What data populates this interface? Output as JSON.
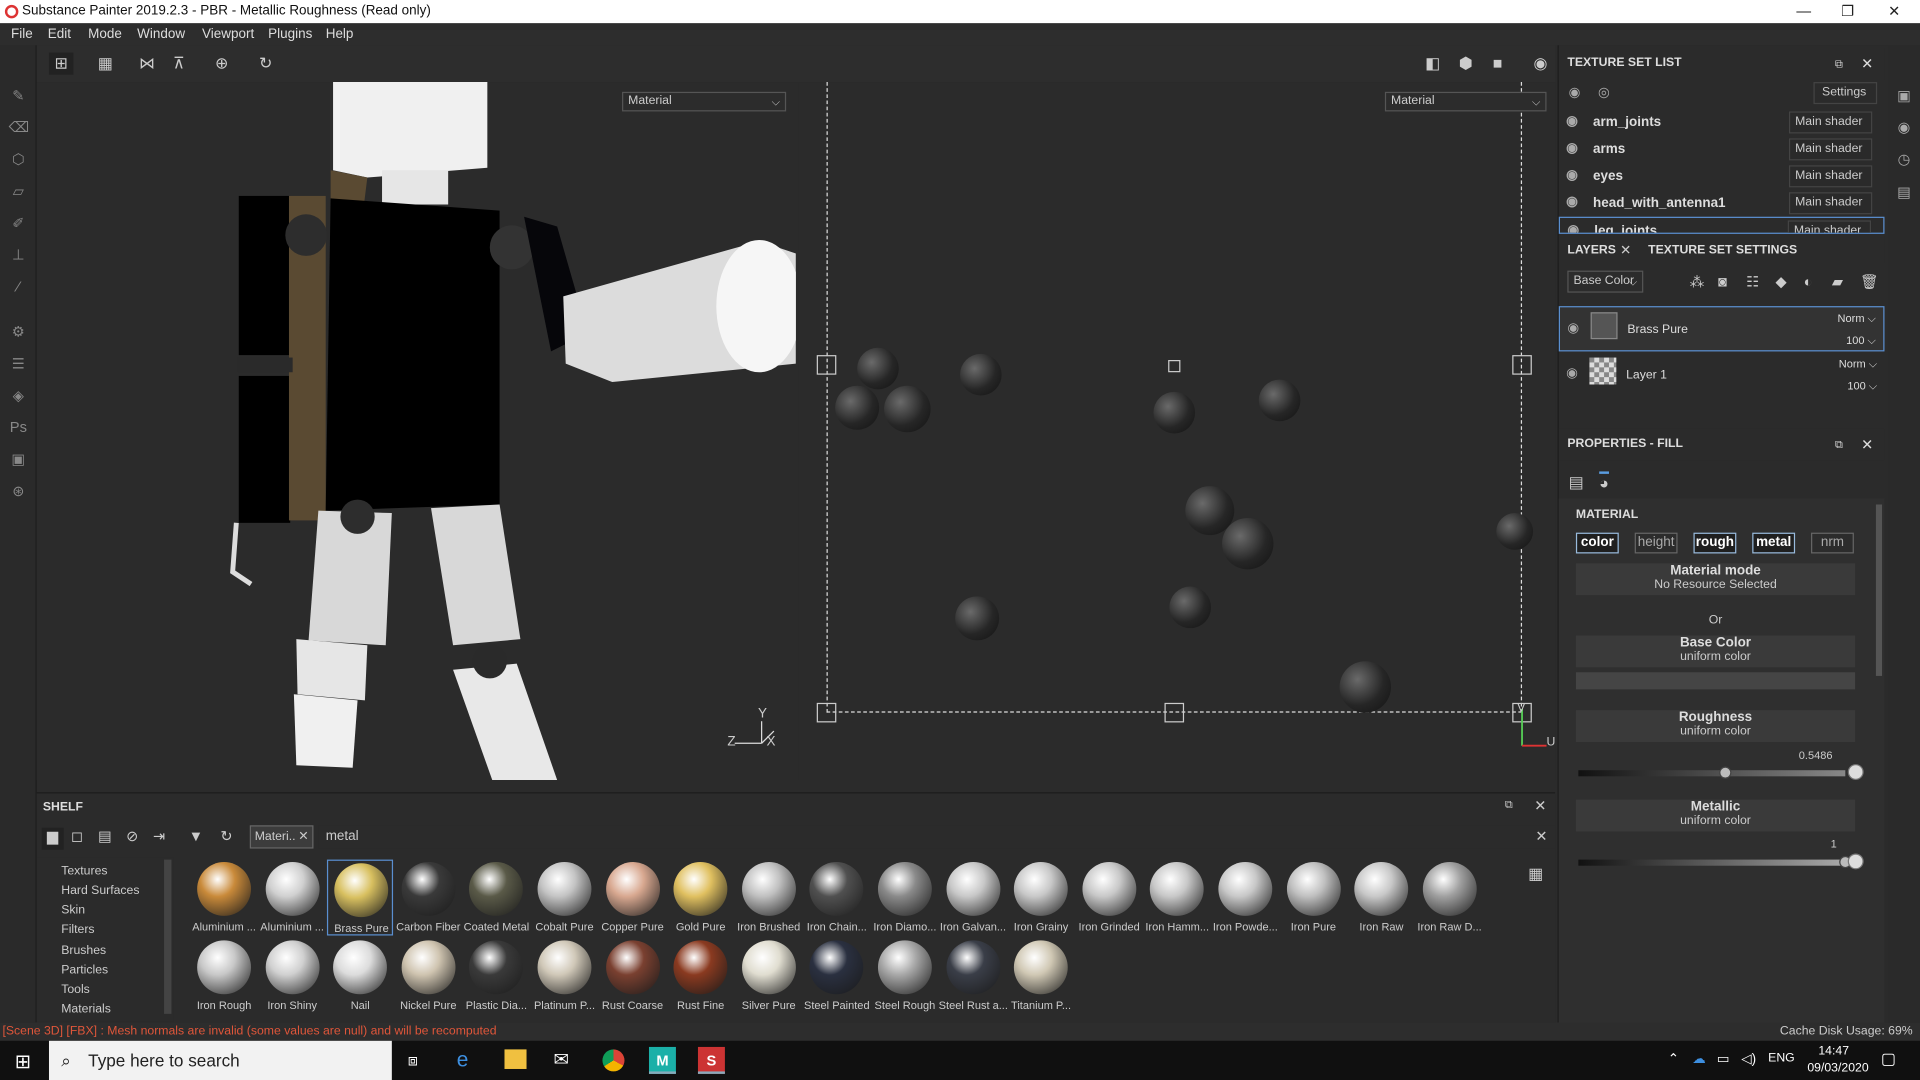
{
  "window": {
    "title": "Substance Painter 2019.2.3 - PBR - Metallic Roughness (Read only)",
    "minimize": "—",
    "maximize": "❐",
    "close": "✕"
  },
  "menu": [
    "File",
    "Edit",
    "Mode",
    "Window",
    "Viewport",
    "Plugins",
    "Help"
  ],
  "viewport": {
    "left_dropdown": "Material",
    "right_dropdown": "Material",
    "axis_y": "Y",
    "axis_z": "Z",
    "axis_x": "X",
    "uv_v": "V",
    "uv_u": "U"
  },
  "texture_set_list": {
    "title": "TEXTURE SET LIST",
    "settings": "Settings",
    "sets": [
      {
        "name": "arm_joints",
        "shader": "Main shader"
      },
      {
        "name": "arms",
        "shader": "Main shader"
      },
      {
        "name": "eyes",
        "shader": "Main shader"
      },
      {
        "name": "head_with_antenna1",
        "shader": "Main shader"
      },
      {
        "name": "leg_joints",
        "shader": "Main shader"
      }
    ]
  },
  "layers": {
    "tab_layers": "LAYERS",
    "tab_tss": "TEXTURE SET SETTINGS",
    "channel": "Base Color",
    "items": [
      {
        "name": "Brass Pure",
        "blend": "Norm",
        "opacity": "100"
      },
      {
        "name": "Layer 1",
        "blend": "Norm",
        "opacity": "100"
      }
    ]
  },
  "properties": {
    "title": "PROPERTIES - FILL",
    "material_label": "MATERIAL",
    "channels": [
      {
        "label": "color",
        "on": true
      },
      {
        "label": "height",
        "on": false
      },
      {
        "label": "rough",
        "on": true
      },
      {
        "label": "metal",
        "on": true
      },
      {
        "label": "nrm",
        "on": false
      }
    ],
    "material_mode": "Material mode",
    "no_resource": "No Resource Selected",
    "or": "Or",
    "base_color": "Base Color",
    "uniform": "uniform color",
    "roughness": "Roughness",
    "roughness_value": "0.5486",
    "roughness_fraction": 0.5486,
    "metallic": "Metallic",
    "metallic_value": "1",
    "metallic_fraction": 1
  },
  "shelf": {
    "title": "SHELF",
    "filter_tag": "Materi..",
    "search": "metal",
    "categories": [
      "Textures",
      "Hard Surfaces",
      "Skin",
      "Filters",
      "Brushes",
      "Particles",
      "Tools",
      "Materials"
    ],
    "materials": [
      {
        "name": "Aluminium ...",
        "color": "#c98a3a"
      },
      {
        "name": "Aluminium ...",
        "color": "#d0d0d0"
      },
      {
        "name": "Brass Pure",
        "color": "#d8c060"
      },
      {
        "name": "Carbon Fiber",
        "color": "#3a3a3a"
      },
      {
        "name": "Coated Metal",
        "color": "#5a5a48"
      },
      {
        "name": "Cobalt Pure",
        "color": "#c4c4c4"
      },
      {
        "name": "Copper Pure",
        "color": "#d8a890"
      },
      {
        "name": "Gold Pure",
        "color": "#e0c060"
      },
      {
        "name": "Iron Brushed",
        "color": "#c0c0c0"
      },
      {
        "name": "Iron Chain...",
        "color": "#505050"
      },
      {
        "name": "Iron Diamo...",
        "color": "#8a8a8a"
      },
      {
        "name": "Iron Galvan...",
        "color": "#c8c8c8"
      },
      {
        "name": "Iron Grainy",
        "color": "#c8c8c8"
      },
      {
        "name": "Iron Grinded",
        "color": "#c8c8c8"
      },
      {
        "name": "Iron Hamm...",
        "color": "#c8c8c8"
      },
      {
        "name": "Iron Powde...",
        "color": "#c8c8c8"
      },
      {
        "name": "Iron Pure",
        "color": "#c0c0c0"
      },
      {
        "name": "Iron Raw",
        "color": "#c8c8c8"
      },
      {
        "name": "Iron Raw D...",
        "color": "#a0a0a0"
      },
      {
        "name": "Iron Rough",
        "color": "#c8c8c8"
      },
      {
        "name": "Iron Shiny",
        "color": "#d0d0d0"
      },
      {
        "name": "Nail",
        "color": "#dcdcdc"
      },
      {
        "name": "Nickel Pure",
        "color": "#cfc4b0"
      },
      {
        "name": "Plastic Dia...",
        "color": "#3a3a3a"
      },
      {
        "name": "Platinum P...",
        "color": "#d0c8b8"
      },
      {
        "name": "Rust Coarse",
        "color": "#7a4030"
      },
      {
        "name": "Rust Fine",
        "color": "#8a3a20"
      },
      {
        "name": "Silver Pure",
        "color": "#e0ddd0"
      },
      {
        "name": "Steel Painted",
        "color": "#2a3040"
      },
      {
        "name": "Steel Rough",
        "color": "#a8a8a8"
      },
      {
        "name": "Steel Rust a...",
        "color": "#3a3e48"
      },
      {
        "name": "Titanium P...",
        "color": "#d0c8b4"
      }
    ]
  },
  "status": {
    "message": "[Scene 3D] [FBX] : Mesh normals are invalid (some values are null) and will be recomputed",
    "cache": "Cache Disk Usage:   69%"
  },
  "taskbar": {
    "search_placeholder": "Type here to search",
    "lang": "ENG",
    "time": "14:47",
    "date": "09/03/2020"
  }
}
